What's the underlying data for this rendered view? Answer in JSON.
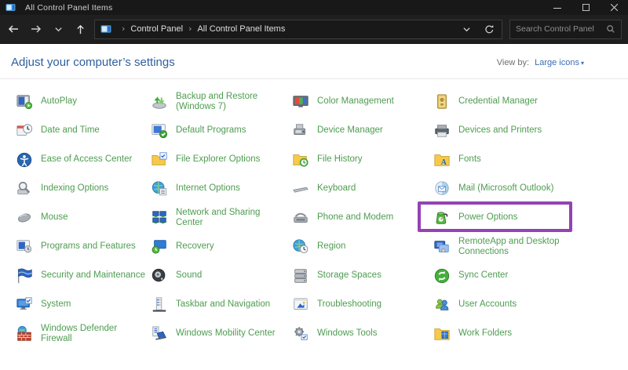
{
  "window": {
    "title": "All Control Panel Items"
  },
  "navbar": {
    "breadcrumb": {
      "root": "Control Panel",
      "current": "All Control Panel Items",
      "separator": "›"
    },
    "search_placeholder": "Search Control Panel"
  },
  "header": {
    "title": "Adjust your computer’s settings",
    "view_by_label": "View by:",
    "view_by_value": "Large icons",
    "view_by_arrow": "▾"
  },
  "items": [
    {
      "label": "AutoPlay",
      "icon": "autoplay-icon"
    },
    {
      "label": "Backup and Restore (Windows 7)",
      "lines": [
        "Backup and Restore",
        "(Windows 7)"
      ],
      "icon": "backup-restore-icon"
    },
    {
      "label": "Color Management",
      "icon": "color-management-icon"
    },
    {
      "label": "Credential Manager",
      "icon": "credential-manager-icon"
    },
    {
      "label": "Date and Time",
      "icon": "date-time-icon"
    },
    {
      "label": "Default Programs",
      "icon": "default-programs-icon"
    },
    {
      "label": "Device Manager",
      "icon": "device-manager-icon"
    },
    {
      "label": "Devices and Printers",
      "icon": "devices-printers-icon"
    },
    {
      "label": "Ease of Access Center",
      "icon": "ease-of-access-icon"
    },
    {
      "label": "File Explorer Options",
      "icon": "file-explorer-options-icon"
    },
    {
      "label": "File History",
      "icon": "file-history-icon"
    },
    {
      "label": "Fonts",
      "icon": "fonts-icon"
    },
    {
      "label": "Indexing Options",
      "icon": "indexing-options-icon"
    },
    {
      "label": "Internet Options",
      "icon": "internet-options-icon"
    },
    {
      "label": "Keyboard",
      "icon": "keyboard-icon"
    },
    {
      "label": "Mail (Microsoft Outlook)",
      "icon": "mail-icon"
    },
    {
      "label": "Mouse",
      "icon": "mouse-icon"
    },
    {
      "label": "Network and Sharing Center",
      "lines": [
        "Network and Sharing",
        "Center"
      ],
      "icon": "network-sharing-icon"
    },
    {
      "label": "Phone and Modem",
      "icon": "phone-modem-icon"
    },
    {
      "label": "Power Options",
      "icon": "power-options-icon",
      "highlighted": true
    },
    {
      "label": "Programs and Features",
      "icon": "programs-features-icon"
    },
    {
      "label": "Recovery",
      "icon": "recovery-icon"
    },
    {
      "label": "Region",
      "icon": "region-icon"
    },
    {
      "label": "RemoteApp and Desktop Connections",
      "lines": [
        "RemoteApp and Desktop",
        "Connections"
      ],
      "icon": "remoteapp-icon"
    },
    {
      "label": "Security and Maintenance",
      "icon": "security-maintenance-icon"
    },
    {
      "label": "Sound",
      "icon": "sound-icon"
    },
    {
      "label": "Storage Spaces",
      "icon": "storage-spaces-icon"
    },
    {
      "label": "Sync Center",
      "icon": "sync-center-icon"
    },
    {
      "label": "System",
      "icon": "system-icon"
    },
    {
      "label": "Taskbar and Navigation",
      "icon": "taskbar-navigation-icon"
    },
    {
      "label": "Troubleshooting",
      "icon": "troubleshooting-icon"
    },
    {
      "label": "User Accounts",
      "icon": "user-accounts-icon"
    },
    {
      "label": "Windows Defender Firewall",
      "lines": [
        "Windows Defender",
        "Firewall"
      ],
      "icon": "defender-firewall-icon"
    },
    {
      "label": "Windows Mobility Center",
      "icon": "mobility-center-icon"
    },
    {
      "label": "Windows Tools",
      "icon": "windows-tools-icon"
    },
    {
      "label": "Work Folders",
      "icon": "work-folders-icon"
    }
  ],
  "highlight": {
    "target": "Power Options",
    "color": "#9442b4"
  },
  "colors": {
    "item_text_green": "#4e9c50",
    "heading_blue": "#2e5f9e",
    "link_blue": "#3a6db5",
    "titlebar_bg": "#181818",
    "navbar_bg": "#1f1f1f",
    "content_bg": "#ffffff",
    "highlight_purple": "#9442b4"
  }
}
